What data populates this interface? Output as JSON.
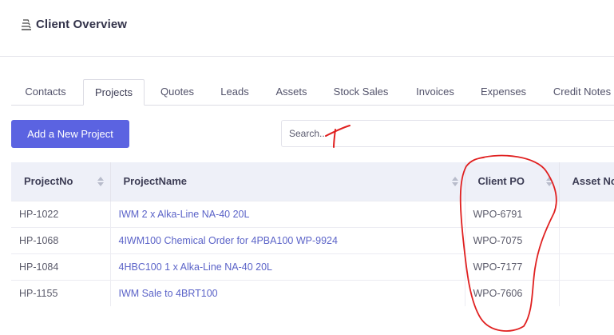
{
  "header": {
    "title": "Client Overview",
    "logo_icon": "stack-icon"
  },
  "tabs": [
    {
      "label": "Contacts",
      "active": false
    },
    {
      "label": "Projects",
      "active": true
    },
    {
      "label": "Quotes",
      "active": false
    },
    {
      "label": "Leads",
      "active": false
    },
    {
      "label": "Assets",
      "active": false
    },
    {
      "label": "Stock Sales",
      "active": false
    },
    {
      "label": "Invoices",
      "active": false
    },
    {
      "label": "Expenses",
      "active": false
    },
    {
      "label": "Credit Notes",
      "active": false
    }
  ],
  "toolbar": {
    "add_label": "Add a New Project",
    "search_placeholder": "Search..."
  },
  "table": {
    "columns": [
      "ProjectNo",
      "ProjectName",
      "Client PO",
      "Asset No"
    ],
    "rows": [
      {
        "project_no": "HP-1022",
        "project_name": "IWM 2 x Alka-Line NA-40 20L",
        "client_po": "WPO-6791",
        "asset_no": ""
      },
      {
        "project_no": "HP-1068",
        "project_name": "4IWM100 Chemical Order for 4PBA100 WP-9924",
        "client_po": "WPO-7075",
        "asset_no": ""
      },
      {
        "project_no": "HP-1084",
        "project_name": "4HBC100 1 x Alka-Line NA-40 20L",
        "client_po": "WPO-7177",
        "asset_no": ""
      },
      {
        "project_no": "HP-1155",
        "project_name": "IWM Sale to 4BRT100",
        "client_po": "WPO-7606",
        "asset_no": ""
      }
    ]
  },
  "colors": {
    "accent": "#5b63e1",
    "link": "#5b63c8",
    "annotation": "#e02020"
  }
}
